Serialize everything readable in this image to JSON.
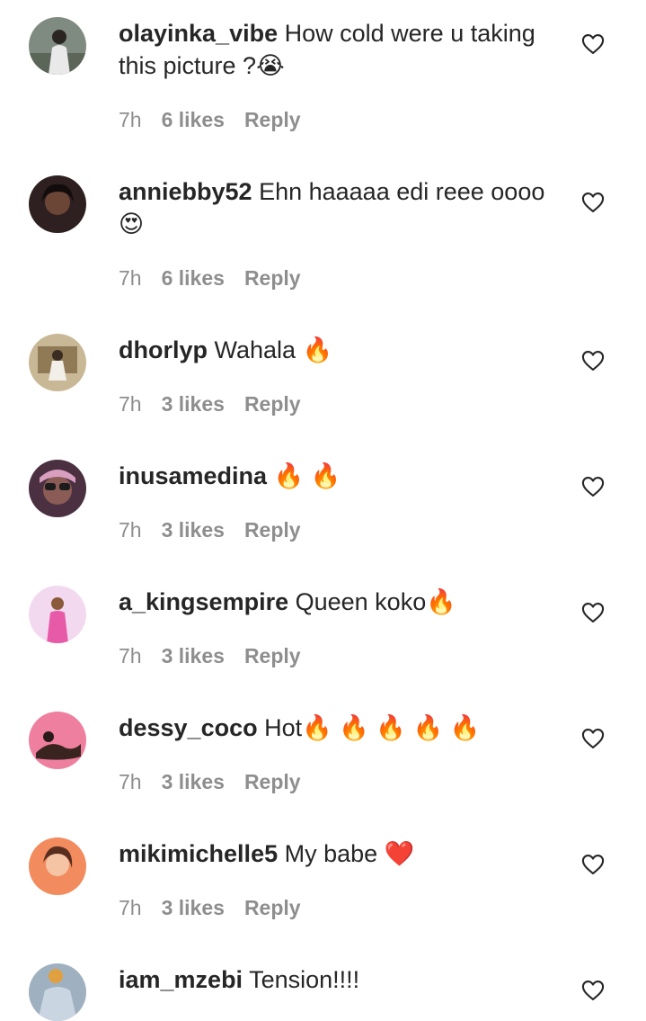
{
  "comments": [
    {
      "username": "olayinka_vibe",
      "text": "How cold were u taking this picture ?😭",
      "time": "7h",
      "likes": "6 likes",
      "reply": "Reply",
      "avatar_color": "#6b7a6e"
    },
    {
      "username": "anniebby52",
      "text": "Ehn haaaaa edi reee oooo 😍",
      "time": "7h",
      "likes": "6 likes",
      "reply": "Reply",
      "avatar_color": "#3a2a2a"
    },
    {
      "username": "dhorlyp",
      "text": "Wahala 🔥",
      "time": "7h",
      "likes": "3 likes",
      "reply": "Reply",
      "avatar_color": "#b8a583"
    },
    {
      "username": "inusamedina",
      "text": "🔥 🔥",
      "time": "7h",
      "likes": "3 likes",
      "reply": "Reply",
      "avatar_color": "#5a3b4a"
    },
    {
      "username": "a_kingsempire",
      "text": "Queen koko🔥",
      "time": "7h",
      "likes": "3 likes",
      "reply": "Reply",
      "avatar_color": "#e6a9d8"
    },
    {
      "username": "dessy_coco",
      "text": "Hot🔥 🔥 🔥 🔥 🔥",
      "time": "7h",
      "likes": "3 likes",
      "reply": "Reply",
      "avatar_color": "#e8668a"
    },
    {
      "username": "mikimichelle5",
      "text": "My babe ❤️",
      "time": "7h",
      "likes": "3 likes",
      "reply": "Reply",
      "avatar_color": "#d9785a"
    },
    {
      "username": "iam_mzebi",
      "text": "Tension!!!!",
      "time": "",
      "likes": "",
      "reply": "",
      "avatar_color": "#8fa2b5"
    }
  ],
  "icons": {
    "like": "heart-outline-icon"
  }
}
